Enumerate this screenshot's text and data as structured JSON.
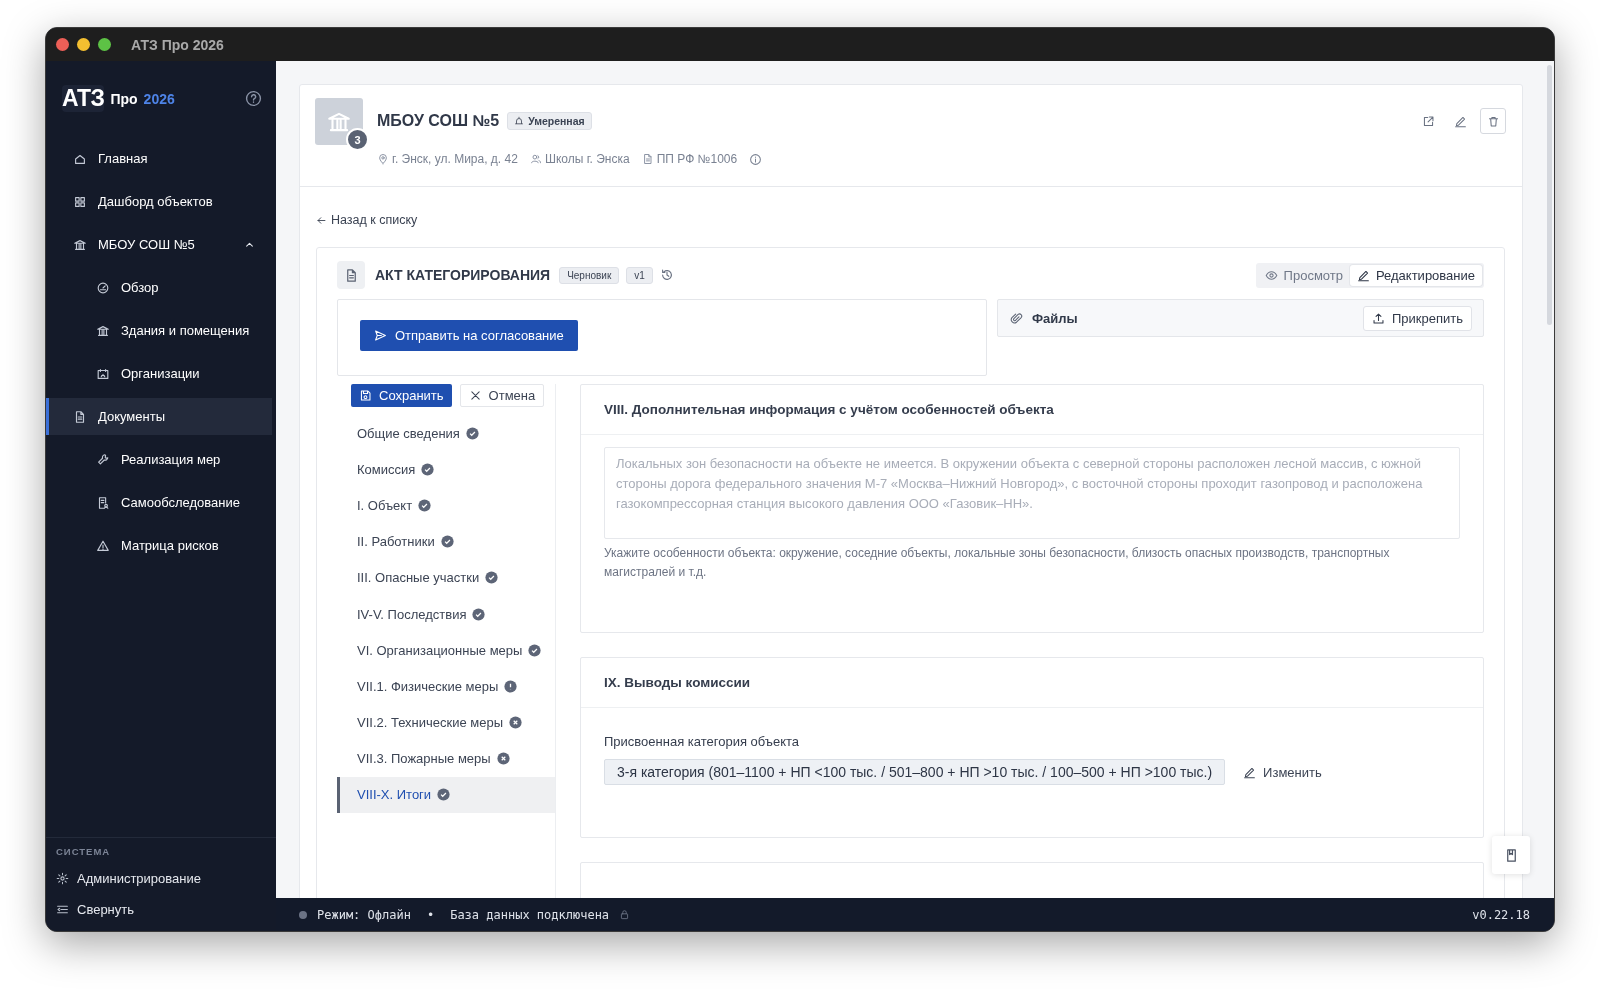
{
  "window": {
    "title": "АТЗ Про 2026"
  },
  "sidebar": {
    "logo": {
      "mark": "АТЗ",
      "product": "Про",
      "year": "2026"
    },
    "items": [
      {
        "label": "Главная",
        "selected": false
      },
      {
        "label": "Дашборд объектов",
        "selected": false
      },
      {
        "label": "МБОУ СОШ №5",
        "selected": false,
        "expanded": true,
        "children": [
          {
            "label": "Обзор",
            "selected": false
          },
          {
            "label": "Здания и помещения",
            "selected": false
          },
          {
            "label": "Организации",
            "selected": false
          }
        ]
      },
      {
        "label": "Документы",
        "selected": true,
        "children": [
          {
            "label": "Реализация мер",
            "selected": false
          },
          {
            "label": "Самообследование",
            "selected": false
          },
          {
            "label": "Матрица рисков",
            "selected": false
          }
        ]
      }
    ],
    "system_title": "СИСТЕМА",
    "system_items": [
      {
        "label": "Администрирование"
      },
      {
        "label": "Свернуть"
      }
    ]
  },
  "header": {
    "title": "МБОУ СОШ №5",
    "count": "3",
    "level_tag": "Умеренная",
    "meta": [
      "г. Энск, ул. Мира, д. 42",
      "Школы г. Энска",
      "ПП РФ №1006"
    ]
  },
  "back_link": "Назад к списку",
  "document": {
    "title": "АКТ КАТЕГОРИРОВАНИЯ",
    "status": "Черновик",
    "version": "v1",
    "modes": [
      {
        "label": "Просмотр",
        "selected": false
      },
      {
        "label": "Редактирование",
        "selected": true
      }
    ],
    "submit": "Отправить на согласование",
    "files": {
      "title": "Файлы",
      "attach": "Прикрепить"
    },
    "save": "Сохранить",
    "cancel": "Отмена",
    "sections": [
      {
        "label": "Общие сведения",
        "kind": "done",
        "selected": false
      },
      {
        "label": "Комиссия",
        "kind": "done",
        "selected": false
      },
      {
        "label": "I. Объект",
        "kind": "done",
        "selected": false
      },
      {
        "label": "II. Работники",
        "kind": "done",
        "selected": false
      },
      {
        "label": "III. Опасные участки",
        "kind": "done",
        "selected": false
      },
      {
        "label": "IV-V. Последствия",
        "kind": "done",
        "selected": false
      },
      {
        "label": "VI. Организационные меры",
        "kind": "done",
        "selected": false
      },
      {
        "label": "VII.1. Физические меры",
        "kind": "warning",
        "selected": false
      },
      {
        "label": "VII.2. Технические меры",
        "kind": "error",
        "selected": false
      },
      {
        "label": "VII.3. Пожарные меры",
        "kind": "error",
        "selected": false
      },
      {
        "label": "VIII-X. Итоги",
        "kind": "done",
        "selected": true
      }
    ],
    "panels": [
      {
        "kind": "textarea",
        "title": "VIII. Дополнительная информация с учётом особенностей объекта",
        "placeholder": "Локальных зон безопасности на объекте не имеется. В окружении объекта с северной стороны расположен лесной массив, с южной стороны дорога федерального значения М-7 «Москва–Нижний Новгород», с восточной стороны проходит газопровод и расположена газокомпрессорная станция высокого давления ООО «Газовик–НН».",
        "hint": "Укажите особенности объекта: окружение, соседние объекты, локальные зоны безопасности, близость опасных производств, транспортных магистралей и т.д."
      },
      {
        "kind": "category",
        "title": "IX. Выводы комиссии",
        "label": "Присвоенная категория объекта",
        "value": "3-я категория (801–1100 + НП <100 тыс. / 501–800 + НП >10 тыс. / 100–500 + НП >100 тыс.)",
        "action": "Изменить"
      },
      {
        "kind": "cut"
      }
    ]
  },
  "status_bar": {
    "mode": "Режим: Офлайн",
    "separator": "•",
    "db": "База данных подключена",
    "version": "v0.22.18"
  }
}
